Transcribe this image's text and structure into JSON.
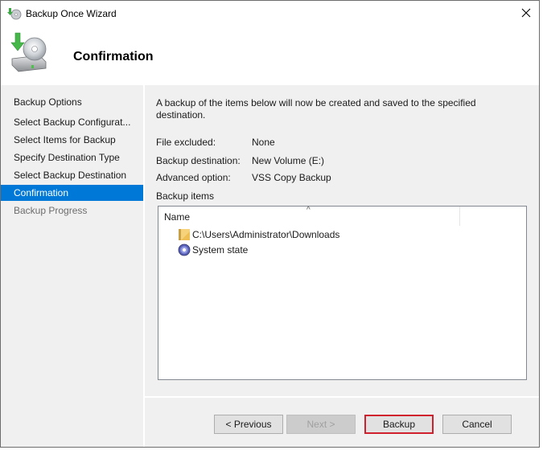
{
  "window": {
    "title": "Backup Once Wizard",
    "app_icon": "backup-wizard-icon",
    "close_icon": "close-icon"
  },
  "header": {
    "title": "Confirmation",
    "icon": "backup-drive-disc-icon"
  },
  "sidebar": {
    "items": [
      {
        "label": "Backup Options",
        "state": "normal"
      },
      {
        "label": "Select Backup Configurat...",
        "state": "normal"
      },
      {
        "label": "Select Items for Backup",
        "state": "normal"
      },
      {
        "label": "Specify Destination Type",
        "state": "normal"
      },
      {
        "label": "Select Backup Destination",
        "state": "normal"
      },
      {
        "label": "Confirmation",
        "state": "active"
      },
      {
        "label": "Backup Progress",
        "state": "disabled"
      }
    ]
  },
  "content": {
    "intro": "A backup of the items below will now be created and saved to the specified destination.",
    "details": [
      {
        "label": "File excluded:",
        "value": "None"
      },
      {
        "label": "Backup destination:",
        "value": "New Volume (E:)"
      },
      {
        "label": "Advanced option:",
        "value": "VSS Copy Backup"
      }
    ],
    "backup_items_label": "Backup items",
    "list": {
      "column_name": "Name",
      "sort_indicator": "^",
      "rows": [
        {
          "icon": "folder-icon",
          "name": "C:\\Users\\Administrator\\Downloads"
        },
        {
          "icon": "system-state-icon",
          "name": "System state"
        }
      ]
    }
  },
  "footer": {
    "previous_label": "< Previous",
    "next_label": "Next >",
    "backup_label": "Backup",
    "cancel_label": "Cancel"
  },
  "colors": {
    "accent": "#0078d7",
    "highlight_border": "#d0202e",
    "panel_bg": "#f0f0f0"
  }
}
